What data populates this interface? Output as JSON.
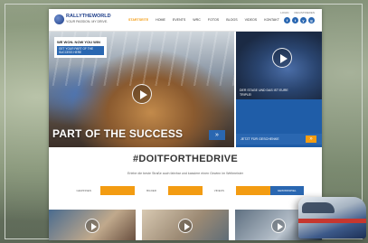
{
  "site": {
    "logo_line1": "RALLYTHEWORLD",
    "logo_line2": "YOUR PASSION. MY DRIVE.",
    "nav": [
      "STARTSEITE",
      "HOME",
      "EVENTS",
      "WRC",
      "FOTOS",
      "BLOGS",
      "VIDEOS",
      "KONTAKT"
    ],
    "toplinks": [
      "LOGIN",
      "REGISTRIEREN"
    ],
    "social": [
      "f",
      "t",
      "y",
      "g"
    ]
  },
  "hero": {
    "promo_title": "WE WON. NOW YOU WIN",
    "promo_sub": "GET YOUR PART OF THE SUCCESS HERE",
    "title": "PART OF THE SUCCESS",
    "arrow": "»",
    "side_caption": "DER STAGE UND DAS IST EURE TRIPLE!",
    "side_button": "JETZT FÜR GESCHENKE",
    "side_button_arrow": "»"
  },
  "campaign": {
    "hashtag": "#DOITFORTHEDRIVE",
    "description": "Erlebe die beste Straße auch fahrbar und kassiere einen Gewinn im Weltmeister",
    "tabs": [
      "GEWINNEN",
      "",
      "BILDER",
      "",
      "VIDEOS",
      "",
      "GEWINNSPIEL"
    ]
  },
  "colors": {
    "accent_orange": "#f39c12",
    "accent_blue": "#2a67b1"
  }
}
